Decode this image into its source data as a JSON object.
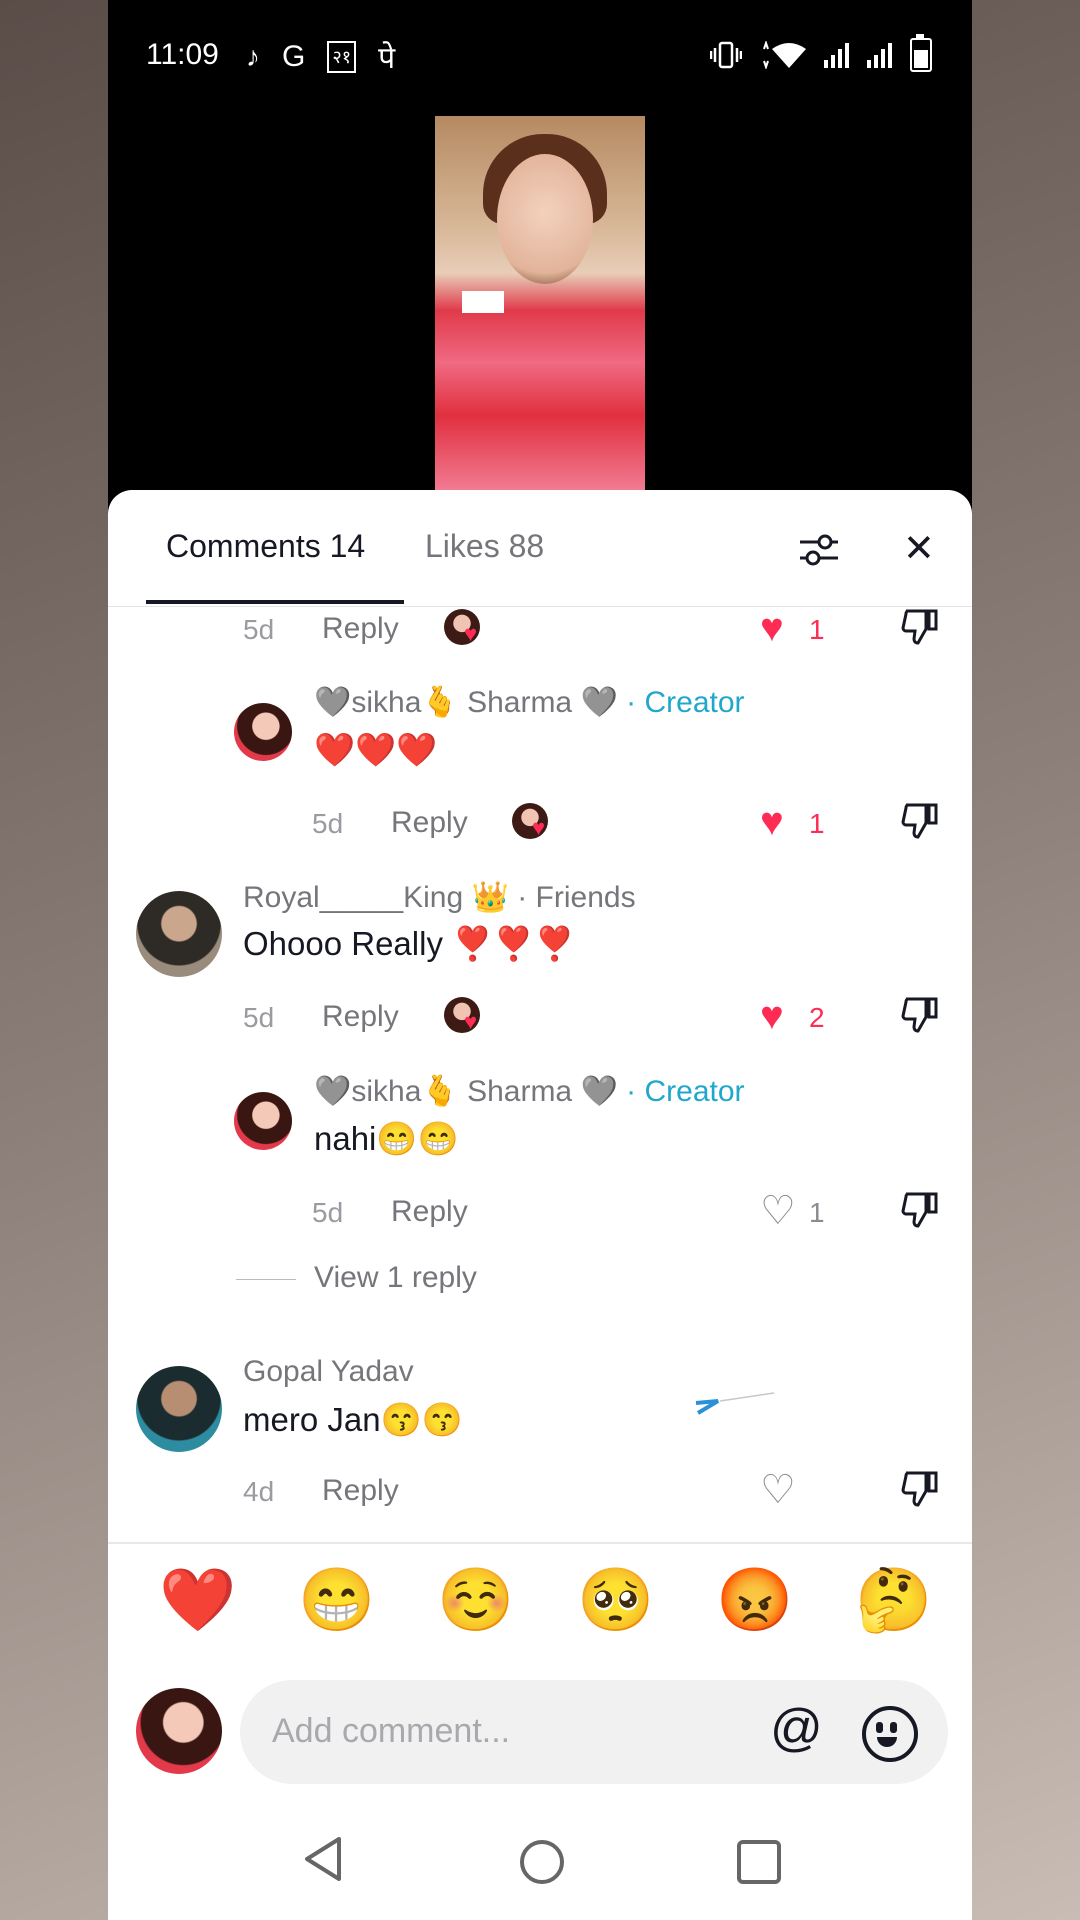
{
  "status_bar": {
    "time": "11:09",
    "g": "G",
    "box": "२१",
    "pe": "पे"
  },
  "tabs": {
    "comments": "Comments 14",
    "likes": "Likes 88"
  },
  "icons": {
    "close": "✕",
    "heart": "♥"
  },
  "comments": [
    {
      "time": "5d",
      "reply": "Reply",
      "likes": "1",
      "liked": true
    },
    {
      "name": "🩶sikha🫰 Sharma 🩶",
      "badge": "· Creator",
      "text": "❤️❤️❤️",
      "time": "5d",
      "reply": "Reply",
      "likes": "1",
      "liked": true
    },
    {
      "name": "Royal_____King 👑",
      "badge": "· Friends",
      "text": "Ohooo Really ❣️❣️❣️",
      "time": "5d",
      "reply": "Reply",
      "likes": "2",
      "liked": true
    },
    {
      "name": "🩶sikha🫰 Sharma 🩶",
      "badge": "· Creator",
      "text": "nahi😁😁",
      "time": "5d",
      "reply": "Reply",
      "likes": "1",
      "liked": false
    },
    {
      "name": "Gopal Yadav",
      "text": "mero Jan😙😙",
      "time": "4d",
      "reply": "Reply",
      "likes": "",
      "liked": false
    }
  ],
  "view_replies": "View 1 reply",
  "quick_emojis": [
    "❤️",
    "😁",
    "☺️",
    "🥺",
    "😡",
    "🤔"
  ],
  "input": {
    "placeholder": "Add comment...",
    "at": "@"
  },
  "colors": {
    "like": "#fe2c55",
    "creator": "#20a8cc",
    "text": "#161823",
    "muted": "#75767b"
  }
}
